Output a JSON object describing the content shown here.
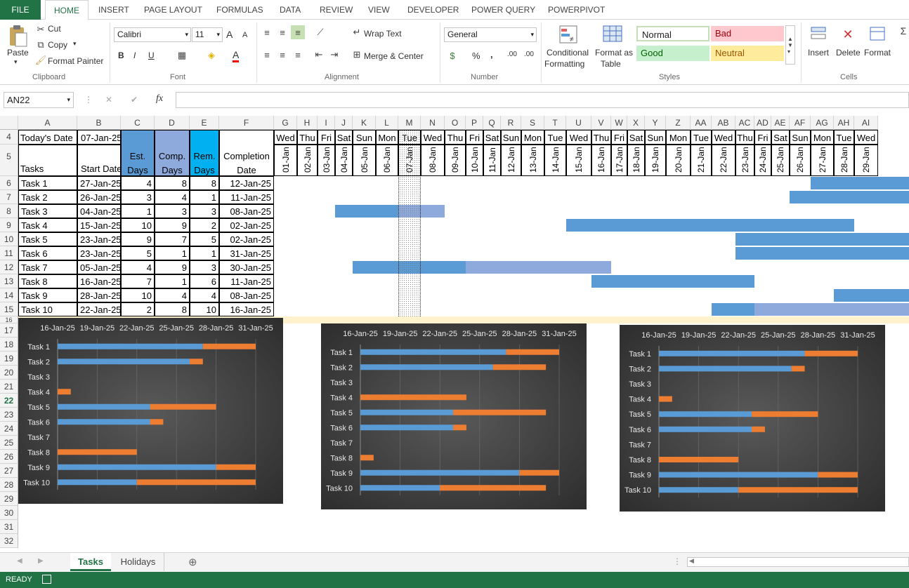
{
  "ribbon": {
    "tabs": [
      "FILE",
      "HOME",
      "INSERT",
      "PAGE LAYOUT",
      "FORMULAS",
      "DATA",
      "REVIEW",
      "VIEW",
      "DEVELOPER",
      "POWER QUERY",
      "POWERPIVOT"
    ],
    "clipboard": {
      "paste": "Paste",
      "cut": "Cut",
      "copy": "Copy",
      "format_painter": "Format Painter",
      "label": "Clipboard"
    },
    "font": {
      "name": "Calibri",
      "size": "11",
      "bold": "B",
      "italic": "I",
      "underline": "U",
      "label": "Font",
      "grow": "A",
      "shrink": "A",
      "font_color": "A"
    },
    "alignment": {
      "wrap": "Wrap Text",
      "merge": "Merge & Center",
      "label": "Alignment"
    },
    "number": {
      "format": "General",
      "percent": "%",
      "comma": ",",
      "inc_dec": ".00",
      "label": "Number"
    },
    "styles": {
      "conditional": "Conditional",
      "conditional2": "Formatting",
      "format_table": "Format as",
      "format_table2": "Table",
      "normal": "Normal",
      "bad": "Bad",
      "good": "Good",
      "neutral": "Neutral",
      "label": "Styles"
    },
    "cells": {
      "insert": "Insert",
      "delete": "Delete",
      "format": "Format",
      "label": "Cells"
    }
  },
  "formula_bar": {
    "name_box": "AN22",
    "fx": "fx",
    "cancel": "✕",
    "enter": "✔",
    "value": ""
  },
  "columns": [
    "A",
    "B",
    "C",
    "D",
    "E",
    "F",
    "G",
    "H",
    "I",
    "J",
    "K",
    "L",
    "M",
    "N",
    "O",
    "P",
    "Q",
    "R",
    "S",
    "T",
    "U",
    "V",
    "W",
    "X",
    "Y",
    "Z",
    "AA",
    "AB",
    "AC",
    "AD",
    "AE",
    "AF",
    "AG",
    "AH",
    "AI"
  ],
  "rows": [
    "4",
    "5",
    "6",
    "7",
    "8",
    "9",
    "10",
    "11",
    "12",
    "13",
    "14",
    "15",
    "16",
    "17",
    "18",
    "19",
    "20",
    "21",
    "22",
    "23",
    "24",
    "25",
    "26",
    "27",
    "28",
    "29",
    "30",
    "31",
    "32"
  ],
  "sheet": {
    "today_label": "Today's Date",
    "today_value": "07-Jan-25",
    "headers": {
      "task": "Tasks",
      "start": "Start Date",
      "est": "Est. Days",
      "comp": "Comp. Days",
      "rem": "Rem. Days",
      "completion": "Completion Date"
    },
    "header_colors": {
      "est": "#5b9bd5",
      "comp": "#8ea9db",
      "rem": "#00b0f0"
    },
    "weekdays": [
      "Wed",
      "Thu",
      "Fri",
      "Sat",
      "Sun",
      "Mon",
      "Tue",
      "Wed",
      "Thu",
      "Fri",
      "Sat",
      "Sun",
      "Mon",
      "Tue",
      "Wed",
      "Thu",
      "Fri",
      "Sat",
      "Sun",
      "Mon",
      "Tue",
      "Wed",
      "Thu",
      "Fri",
      "Sat",
      "Sun",
      "Mon",
      "Tue",
      "Wed"
    ],
    "dates": [
      "01-Jan",
      "02-Jan",
      "03-Jan",
      "04-Jan",
      "05-Jan",
      "06-Jan",
      "07-Jan",
      "08-Jan",
      "09-Jan",
      "10-Jan",
      "11-Jan",
      "12-Jan",
      "13-Jan",
      "14-Jan",
      "15-Jan",
      "16-Jan",
      "17-Jan",
      "18-Jan",
      "19-Jan",
      "20-Jan",
      "21-Jan",
      "22-Jan",
      "23-Jan",
      "24-Jan",
      "25-Jan",
      "26-Jan",
      "27-Jan",
      "28-Jan",
      "29-Jan"
    ],
    "tasks": [
      {
        "name": "Task 1",
        "start": "27-Jan-25",
        "est": "4",
        "comp": "8",
        "rem": "8",
        "completion": "12-Jan-25"
      },
      {
        "name": "Task 2",
        "start": "26-Jan-25",
        "est": "3",
        "comp": "4",
        "rem": "1",
        "completion": "11-Jan-25"
      },
      {
        "name": "Task 3",
        "start": "04-Jan-25",
        "est": "1",
        "comp": "3",
        "rem": "3",
        "completion": "08-Jan-25"
      },
      {
        "name": "Task 4",
        "start": "15-Jan-25",
        "est": "10",
        "comp": "9",
        "rem": "2",
        "completion": "02-Jan-25"
      },
      {
        "name": "Task 5",
        "start": "23-Jan-25",
        "est": "9",
        "comp": "7",
        "rem": "5",
        "completion": "02-Jan-25"
      },
      {
        "name": "Task 6",
        "start": "23-Jan-25",
        "est": "5",
        "comp": "1",
        "rem": "1",
        "completion": "31-Jan-25"
      },
      {
        "name": "Task 7",
        "start": "05-Jan-25",
        "est": "4",
        "comp": "9",
        "rem": "3",
        "completion": "30-Jan-25"
      },
      {
        "name": "Task 8",
        "start": "16-Jan-25",
        "est": "7",
        "comp": "1",
        "rem": "6",
        "completion": "11-Jan-25"
      },
      {
        "name": "Task 9",
        "start": "28-Jan-25",
        "est": "10",
        "comp": "4",
        "rem": "4",
        "completion": "08-Jan-25"
      },
      {
        "name": "Task 10",
        "start": "22-Jan-25",
        "est": "2",
        "comp": "8",
        "rem": "10",
        "completion": "16-Jan-25"
      }
    ]
  },
  "gantt_colors": {
    "done": "#5b9bd5",
    "remaining": "#8ea9db"
  },
  "chart_data": [
    {
      "type": "bar",
      "x_ticks": [
        "16-Jan-25",
        "19-Jan-25",
        "22-Jan-25",
        "25-Jan-25",
        "28-Jan-25",
        "31-Jan-25"
      ],
      "categories": [
        "Task 1",
        "Task 2",
        "Task 3",
        "Task 4",
        "Task 5",
        "Task 6",
        "Task 7",
        "Task 8",
        "Task 9",
        "Task 10"
      ],
      "series": [
        {
          "color": "#5b9bd5",
          "values": [
            "16-Jan-25",
            "16-Jan-25",
            null,
            null,
            "16-Jan-25",
            "16-Jan-25",
            null,
            null,
            "16-Jan-25",
            "16-Jan-25"
          ],
          "ends": [
            "27-Jan-25",
            "26-Jan-25",
            null,
            null,
            "23-Jan-25",
            "23-Jan-25",
            null,
            null,
            "28-Jan-25",
            "22-Jan-25"
          ]
        },
        {
          "color": "#ed7d31",
          "starts": [
            "27-Jan-25",
            "26-Jan-25",
            null,
            "16-Jan-25",
            "23-Jan-25",
            "23-Jan-25",
            null,
            "16-Jan-25",
            "28-Jan-25",
            "22-Jan-25"
          ],
          "ends": [
            "31-Jan-25",
            "27-Jan-25",
            null,
            "17-Jan-25",
            "28-Jan-25",
            "24-Jan-25",
            null,
            "22-Jan-25",
            "31-Jan-25",
            "31-Jan-25"
          ]
        }
      ],
      "xlim": [
        "16-Jan-25",
        "31-Jan-25"
      ]
    },
    {
      "type": "bar",
      "x_ticks": [
        "16-Jan-25",
        "19-Jan-25",
        "22-Jan-25",
        "25-Jan-25",
        "28-Jan-25",
        "31-Jan-25"
      ],
      "categories": [
        "Task 1",
        "Task 2",
        "Task 3",
        "Task 4",
        "Task 5",
        "Task 6",
        "Task 7",
        "Task 8",
        "Task 9",
        "Task 10"
      ],
      "series": [
        {
          "color": "#5b9bd5",
          "values": [
            "16-Jan-25",
            "16-Jan-25",
            null,
            null,
            "16-Jan-25",
            "16-Jan-25",
            null,
            null,
            "16-Jan-25",
            "16-Jan-25"
          ],
          "ends": [
            "27-Jan-25",
            "26-Jan-25",
            null,
            null,
            "23-Jan-25",
            "23-Jan-25",
            null,
            null,
            "28-Jan-25",
            "22-Jan-25"
          ]
        },
        {
          "color": "#ed7d31",
          "starts": [
            "27-Jan-25",
            "26-Jan-25",
            null,
            "16-Jan-25",
            "23-Jan-25",
            "23-Jan-25",
            null,
            "16-Jan-25",
            "28-Jan-25",
            "22-Jan-25"
          ],
          "ends": [
            "31-Jan-25",
            "30-Jan-25",
            null,
            "24-Jan-25",
            "30-Jan-25",
            "24-Jan-25",
            null,
            "17-Jan-25",
            "31-Jan-25",
            "30-Jan-25"
          ]
        }
      ],
      "xlim": [
        "16-Jan-25",
        "31-Jan-25"
      ]
    },
    {
      "type": "bar",
      "x_ticks": [
        "16-Jan-25",
        "19-Jan-25",
        "22-Jan-25",
        "25-Jan-25",
        "28-Jan-25",
        "31-Jan-25"
      ],
      "categories": [
        "Task 1",
        "Task 2",
        "Task 3",
        "Task 4",
        "Task 5",
        "Task 6",
        "Task 7",
        "Task 8",
        "Task 9",
        "Task 10"
      ],
      "series": [
        {
          "color": "#5b9bd5",
          "values": [
            "16-Jan-25",
            "16-Jan-25",
            null,
            null,
            "16-Jan-25",
            "16-Jan-25",
            null,
            null,
            "16-Jan-25",
            "16-Jan-25"
          ],
          "ends": [
            "27-Jan-25",
            "26-Jan-25",
            null,
            null,
            "23-Jan-25",
            "23-Jan-25",
            null,
            null,
            "28-Jan-25",
            "22-Jan-25"
          ]
        },
        {
          "color": "#ed7d31",
          "starts": [
            "27-Jan-25",
            "26-Jan-25",
            null,
            "16-Jan-25",
            "23-Jan-25",
            "23-Jan-25",
            null,
            "16-Jan-25",
            "28-Jan-25",
            "22-Jan-25"
          ],
          "ends": [
            "31-Jan-25",
            "27-Jan-25",
            null,
            "17-Jan-25",
            "28-Jan-25",
            "24-Jan-25",
            null,
            "22-Jan-25",
            "31-Jan-25",
            "31-Jan-25"
          ]
        }
      ],
      "xlim": [
        "16-Jan-25",
        "31-Jan-25"
      ]
    }
  ],
  "sheet_tabs": [
    "Tasks",
    "Holidays"
  ],
  "status": {
    "ready": "READY"
  }
}
